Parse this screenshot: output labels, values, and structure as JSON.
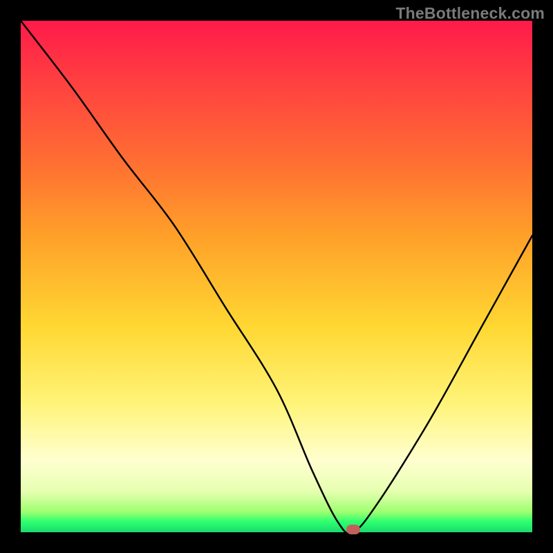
{
  "watermark": "TheBottleneck.com",
  "chart_data": {
    "type": "line",
    "title": "",
    "xlabel": "",
    "ylabel": "",
    "xlim": [
      0,
      100
    ],
    "ylim": [
      0,
      100
    ],
    "x": [
      0,
      10,
      20,
      30,
      40,
      50,
      57,
      62,
      65,
      70,
      80,
      90,
      100
    ],
    "values": [
      100,
      87,
      73,
      60,
      44,
      28,
      12,
      2,
      0,
      6,
      22,
      40,
      58
    ],
    "marker": {
      "x": 65,
      "y": 0,
      "color": "#c3605c"
    },
    "background": "vertical-gradient red→orange→yellow→green"
  }
}
